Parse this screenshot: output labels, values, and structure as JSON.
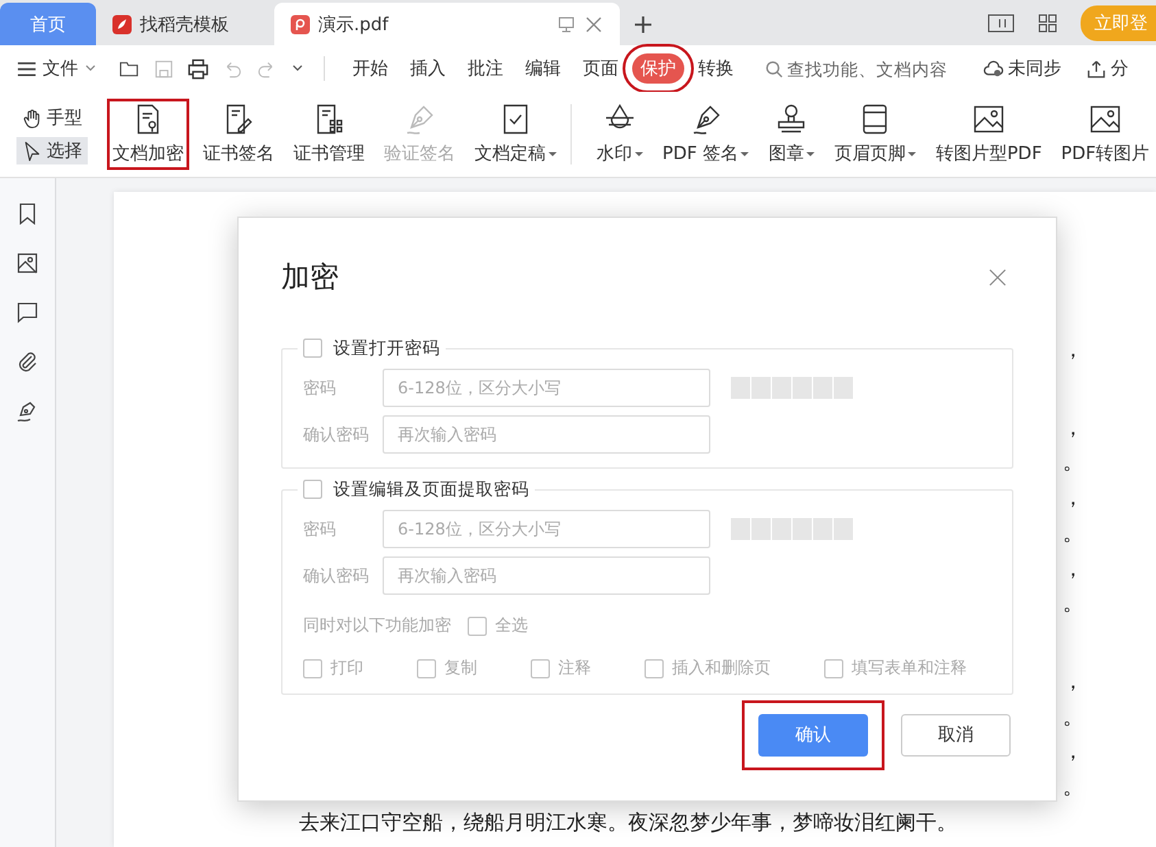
{
  "tabs": [
    {
      "label": "首页",
      "kind": "home",
      "selected": false
    },
    {
      "label": "找稻壳模板",
      "kind": "template",
      "selected": false
    },
    {
      "label": "演示.pdf",
      "kind": "pdf",
      "selected": true
    }
  ],
  "login": "立即登",
  "menu": {
    "file": "文件",
    "tabs": [
      {
        "label": "开始",
        "selected": false,
        "highlighted": false
      },
      {
        "label": "插入",
        "selected": false,
        "highlighted": false
      },
      {
        "label": "批注",
        "selected": false,
        "highlighted": false
      },
      {
        "label": "编辑",
        "selected": false,
        "highlighted": false
      },
      {
        "label": "页面",
        "selected": false,
        "highlighted": false
      },
      {
        "label": "保护",
        "selected": true,
        "highlighted": true
      },
      {
        "label": "转换",
        "selected": false,
        "highlighted": false
      }
    ],
    "search": {
      "placeholder": "查找功能、文档内容"
    },
    "sync": "未同步",
    "share": "分"
  },
  "ribbon": {
    "modes": [
      {
        "label": "手型",
        "kind": "hand",
        "selected": false
      },
      {
        "label": "选择",
        "kind": "pointer",
        "selected": true
      }
    ],
    "groups": [
      [
        {
          "label": "文档加密",
          "kind": "doc-lock",
          "dropdown": false,
          "disabled": false,
          "highlighted": true
        },
        {
          "label": "证书签名",
          "kind": "cert-sign",
          "dropdown": false,
          "disabled": false,
          "highlighted": false
        },
        {
          "label": "证书管理",
          "kind": "cert-manage",
          "dropdown": false,
          "disabled": false,
          "highlighted": false
        },
        {
          "label": "验证签名",
          "kind": "pen",
          "dropdown": false,
          "disabled": true,
          "highlighted": false
        },
        {
          "label": "文档定稿",
          "kind": "doc-check",
          "dropdown": true,
          "disabled": false,
          "highlighted": false
        }
      ],
      [
        {
          "label": "水印",
          "kind": "watermark",
          "dropdown": true,
          "disabled": false,
          "highlighted": false
        },
        {
          "label": "PDF 签名",
          "kind": "pen",
          "dropdown": true,
          "disabled": false,
          "highlighted": false
        },
        {
          "label": "图章",
          "kind": "stamp",
          "dropdown": true,
          "disabled": false,
          "highlighted": false
        },
        {
          "label": "页眉页脚",
          "kind": "header-footer",
          "dropdown": true,
          "disabled": false,
          "highlighted": false
        },
        {
          "label": "转图片型PDF",
          "kind": "image",
          "dropdown": false,
          "disabled": false,
          "highlighted": false
        },
        {
          "label": "PDF转图片",
          "kind": "image",
          "dropdown": false,
          "disabled": false,
          "highlighted": false
        }
      ]
    ]
  },
  "sidebar": {
    "items": [
      {
        "kind": "bookmark"
      },
      {
        "kind": "image"
      },
      {
        "kind": "comment"
      },
      {
        "kind": "attachment"
      },
      {
        "kind": "signature"
      }
    ]
  },
  "document": {
    "paragraphs": [
      {
        "fragments": [
          "，"
        ]
      },
      {
        "fragments": [
          "，",
          "。",
          "，",
          "。",
          "，",
          "。"
        ]
      },
      {
        "fragments": [
          "，",
          "。",
          "，",
          "。"
        ]
      }
    ],
    "last_line": "去来江口守空船，绕船月明江水寒。夜深忽梦少年事，梦啼妆泪红阑干。"
  },
  "dialog": {
    "title": "加密",
    "sections": [
      {
        "label": "设置打开密码",
        "checked": false,
        "password_label": "密码",
        "password_placeholder": "6-128位，区分大小写",
        "strength": {
          "level": 0
        },
        "confirm_label": "确认密码",
        "confirm_placeholder": "再次输入密码"
      },
      {
        "label": "设置编辑及页面提取密码",
        "checked": false,
        "password_label": "密码",
        "password_placeholder": "6-128位，区分大小写",
        "strength": {
          "level": 0
        },
        "confirm_label": "确认密码",
        "confirm_placeholder": "再次输入密码",
        "options_label": "同时对以下功能加密",
        "select_all": {
          "label": "全选",
          "checked": false
        },
        "options": [
          {
            "label": "打印",
            "checked": false
          },
          {
            "label": "复制",
            "checked": false
          },
          {
            "label": "注释",
            "checked": false
          },
          {
            "label": "插入和删除页",
            "checked": false
          },
          {
            "label": "填写表单和注释",
            "checked": false
          }
        ]
      }
    ],
    "buttons": [
      {
        "label": "确认",
        "kind": "primary",
        "highlighted": true
      },
      {
        "label": "取消",
        "kind": "secondary",
        "highlighted": false
      }
    ]
  }
}
